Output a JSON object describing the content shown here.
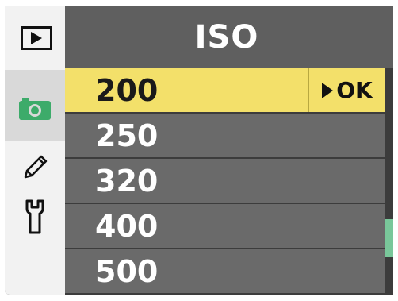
{
  "menu": {
    "title": "ISO",
    "tabs": [
      {
        "icon": "playback-icon"
      },
      {
        "icon": "camera-icon",
        "active": true
      },
      {
        "icon": "pencil-icon"
      },
      {
        "icon": "wrench-icon"
      }
    ],
    "options": [
      "200",
      "250",
      "320",
      "400",
      "500"
    ],
    "selected_index": 0,
    "confirm_label": "OK"
  },
  "colors": {
    "highlight": "#f3e06a",
    "title_bar": "#5f5f5f",
    "row": "#6a6a6a",
    "scroll_thumb": "#79c79a",
    "camera_icon": "#3dab6a"
  },
  "scroll": {
    "position_fraction": 0.8
  }
}
